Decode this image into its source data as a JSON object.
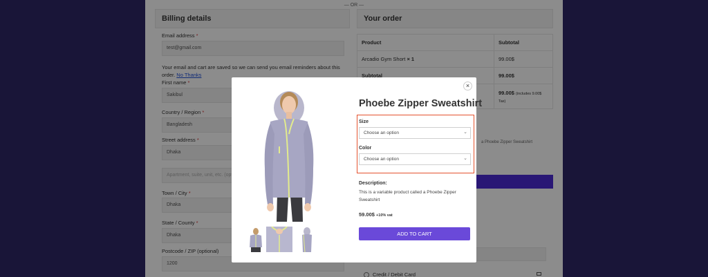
{
  "checkout": {
    "or_divider": "— OR —",
    "billing": {
      "title": "Billing details",
      "email_label": "Email address",
      "email_value": "test@gmail.com",
      "save_note": "Your email and cart are saved so we can send you email reminders about this order.",
      "no_thanks": "No Thanks",
      "first_name_label": "First name",
      "first_name_value": "Sakibul",
      "country_label": "Country / Region",
      "country_value": "Bangladesh",
      "street_label": "Street address",
      "street_value": "Dhaka",
      "street2_placeholder": "Apartment, suite, unit, etc. (optional)",
      "city_label": "Town / City",
      "city_value": "Dhaka",
      "state_label": "State / County",
      "state_value": "Dhaka",
      "postcode_label": "Postcode / ZIP (optional)",
      "postcode_value": "1200",
      "required_mark": "*"
    },
    "order": {
      "title": "Your order",
      "col_product": "Product",
      "col_subtotal": "Subtotal",
      "item_name": "Arcadio Gym Short",
      "item_qty": "× 1",
      "item_subtotal": "99.00$",
      "subtotal_label": "Subtotal",
      "subtotal_value": "99.00$",
      "total_value": "99.00$",
      "total_note": "(includes 9.00$",
      "total_note2": "Tax)",
      "side_text": "a Phoebe Zipper Sweatshirt",
      "payment_option": "Credit / Debit Card"
    }
  },
  "modal": {
    "close": "×",
    "title": "Phoebe Zipper Sweatshirt",
    "size_label": "Size",
    "size_value": "Choose an option",
    "color_label": "Color",
    "color_value": "Choose an option",
    "desc_label": "Description:",
    "desc_text": "This is a variable product called a Phoebe Zipper Sweatshirt",
    "price": "59.00$",
    "vat": "+10% vat",
    "add_to_cart": "ADD TO CART",
    "accent_color": "#6a49d9",
    "highlight_color": "#e4502c"
  }
}
